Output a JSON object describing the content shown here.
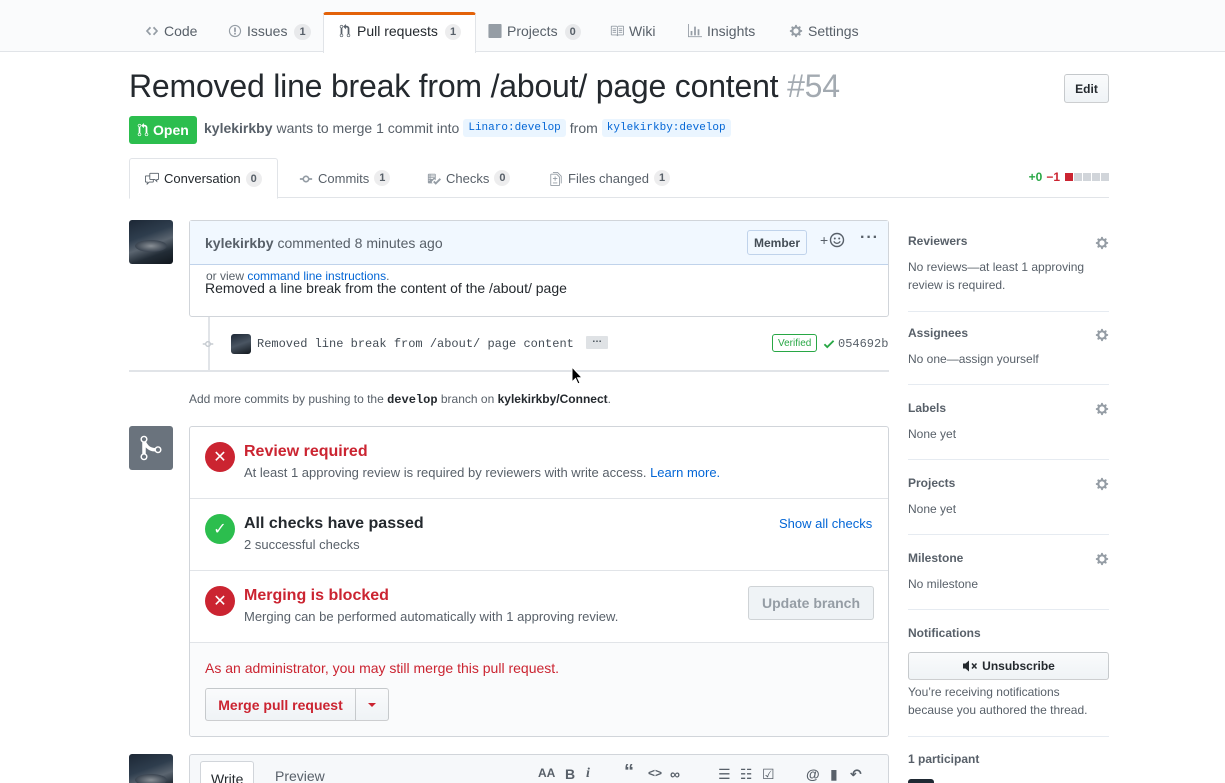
{
  "reponav": {
    "code": "Code",
    "issues": "Issues",
    "issues_count": "1",
    "pulls": "Pull requests",
    "pulls_count": "1",
    "projects": "Projects",
    "projects_count": "0",
    "wiki": "Wiki",
    "insights": "Insights",
    "settings": "Settings"
  },
  "pr": {
    "title": "Removed line break from /about/ page content",
    "number": "#54",
    "edit": "Edit",
    "state": "Open",
    "author": "kylekirkby",
    "wants": "wants to merge 1 commit into",
    "base": "Linaro:develop",
    "from": "from",
    "head": "kylekirkby:develop"
  },
  "tabs": {
    "conversation": "Conversation",
    "conversation_count": "0",
    "commits": "Commits",
    "commits_count": "1",
    "checks": "Checks",
    "checks_count": "0",
    "files": "Files changed",
    "files_count": "1",
    "additions": "+0",
    "deletions": "−1"
  },
  "comment": {
    "author": "kylekirkby",
    "action": "commented",
    "time": "8 minutes ago",
    "role": "Member",
    "react_plus": "+",
    "body": "Removed a line break from the content of the /about/ page"
  },
  "commit": {
    "message": "Removed line break from /about/ page content",
    "ellipsis": "…",
    "verified": "Verified",
    "sha": "054692b"
  },
  "add_commits": {
    "prefix": "Add more commits by pushing to the",
    "branch": "develop",
    "middle": "branch on",
    "repo": "kylekirkby/Connect",
    "suffix": "."
  },
  "merge": {
    "review_title": "Review required",
    "review_sub": "At least 1 approving review is required by reviewers with write access.",
    "learn_more": "Learn more.",
    "checks_title": "All checks have passed",
    "checks_sub": "2 successful checks",
    "show_checks": "Show all checks",
    "blocked_title": "Merging is blocked",
    "blocked_sub": "Merging can be performed automatically with 1 approving review.",
    "update_branch": "Update branch",
    "admin_text": "As an administrator, you may still merge this pull request.",
    "merge_button": "Merge pull request",
    "or_view": "or view",
    "cli": "command line instructions",
    "period": "."
  },
  "sidebar": {
    "reviewers": "Reviewers",
    "reviewers_val": "No reviews—at least 1 approving review is required.",
    "assignees": "Assignees",
    "assignees_val": "No one—assign yourself",
    "labels": "Labels",
    "labels_val": "None yet",
    "projects": "Projects",
    "projects_val": "None yet",
    "milestone": "Milestone",
    "milestone_val": "No milestone",
    "notifications": "Notifications",
    "unsubscribe": "Unsubscribe",
    "notif_reason": "You’re receiving notifications because you authored the thread.",
    "participants": "1 participant"
  },
  "composer": {
    "write": "Write",
    "preview": "Preview",
    "tools": [
      "AA",
      "B",
      "i",
      "“",
      "<>",
      "∞",
      "☰",
      "☷",
      "☑",
      "@",
      "▮",
      "↶"
    ]
  },
  "colors": {
    "open_green": "#2cbe4e",
    "blocked_red": "#cb2431",
    "link_blue": "#0366d6",
    "nav_orange": "#e36209"
  }
}
